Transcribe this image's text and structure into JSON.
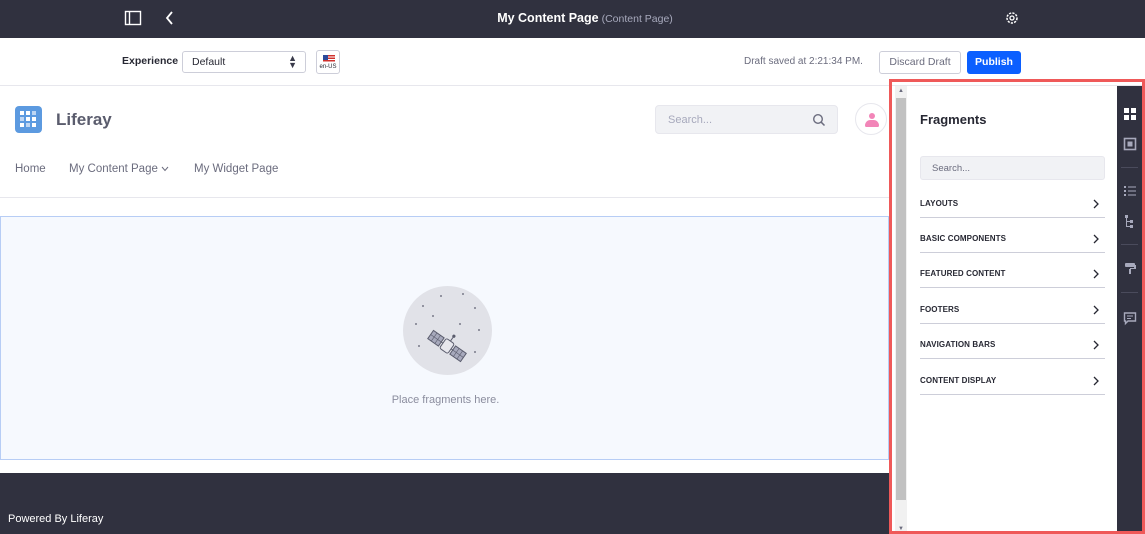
{
  "topbar": {
    "title": "My Content Page",
    "subtitle": "(Content Page)"
  },
  "toolbar": {
    "experience_label": "Experience",
    "experience_value": "Default",
    "language_code": "en-US",
    "status": "Draft saved at 2:21:34 PM.",
    "discard_label": "Discard Draft",
    "publish_label": "Publish"
  },
  "site": {
    "name": "Liferay",
    "search_placeholder": "Search..."
  },
  "nav": {
    "items": [
      "Home",
      "My Content Page",
      "My Widget Page"
    ]
  },
  "dropzone": {
    "message": "Place fragments here."
  },
  "footer": {
    "text": "Powered By Liferay"
  },
  "fragments_panel": {
    "title": "Fragments",
    "search_placeholder": "Search...",
    "collections": [
      "LAYOUTS",
      "BASIC COMPONENTS",
      "FEATURED CONTENT",
      "FOOTERS",
      "NAVIGATION BARS",
      "CONTENT DISPLAY"
    ]
  },
  "sidebar_rail": {
    "icons": [
      "fragments-icon",
      "widgets-icon",
      "page-structure-icon",
      "mapping-icon",
      "look-and-feel-icon",
      "comments-icon"
    ]
  },
  "colors": {
    "topbar_bg": "#30313f",
    "primary_button": "#0b5fff",
    "highlight_border": "#ef5959",
    "dropzone_bg": "#f6f9fe",
    "logo_blue": "#5c9ae0"
  }
}
